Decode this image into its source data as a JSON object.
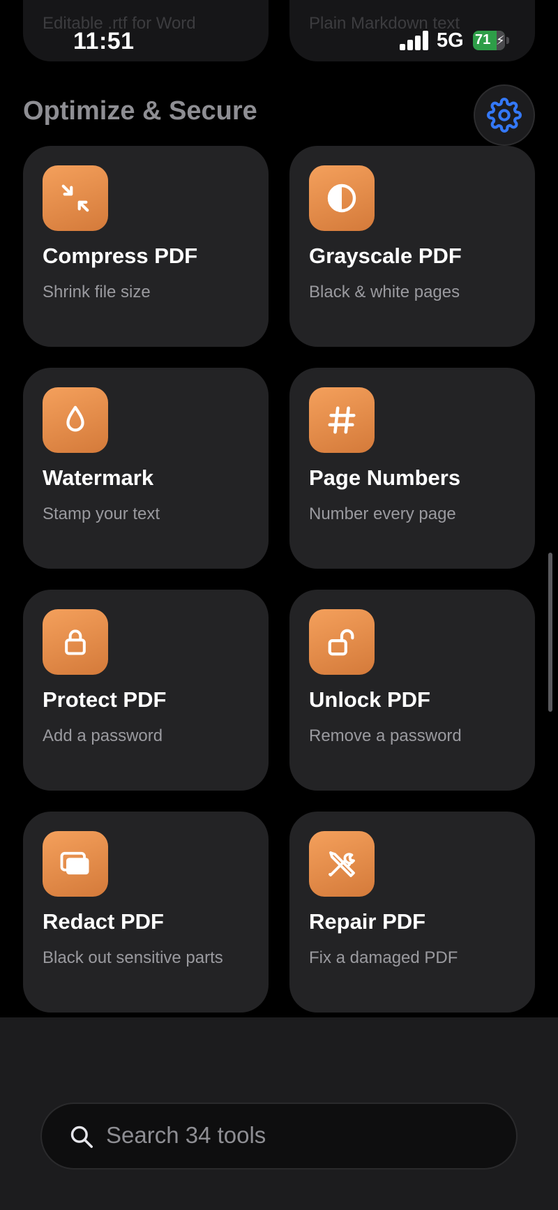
{
  "status_bar": {
    "time": "11:51",
    "network": "5G",
    "battery": "71"
  },
  "top_cards": [
    {
      "subtitle": "Editable .rtf for Word"
    },
    {
      "subtitle": "Plain Markdown text"
    }
  ],
  "section": {
    "title": "Optimize & Secure",
    "settings_icon": "gear-icon"
  },
  "tools": [
    {
      "title": "Compress PDF",
      "subtitle": "Shrink file size",
      "icon": "compress-arrows-icon"
    },
    {
      "title": "Grayscale PDF",
      "subtitle": "Black & white pages",
      "icon": "half-circle-icon"
    },
    {
      "title": "Watermark",
      "subtitle": "Stamp your text",
      "icon": "drop-icon"
    },
    {
      "title": "Page Numbers",
      "subtitle": "Number every page",
      "icon": "hash-icon"
    },
    {
      "title": "Protect PDF",
      "subtitle": "Add a password",
      "icon": "lock-icon"
    },
    {
      "title": "Unlock PDF",
      "subtitle": "Remove a password",
      "icon": "unlock-icon"
    },
    {
      "title": "Redact PDF",
      "subtitle": "Black out sensitive parts",
      "icon": "redact-rectangles-icon"
    },
    {
      "title": "Repair PDF",
      "subtitle": "Fix a damaged PDF",
      "icon": "tools-icon"
    }
  ],
  "search": {
    "placeholder": "Search 34 tools"
  },
  "colors": {
    "accent_icon_tile": "#E8894A",
    "settings_icon": "#3478F6",
    "card_bg": "#232325"
  }
}
